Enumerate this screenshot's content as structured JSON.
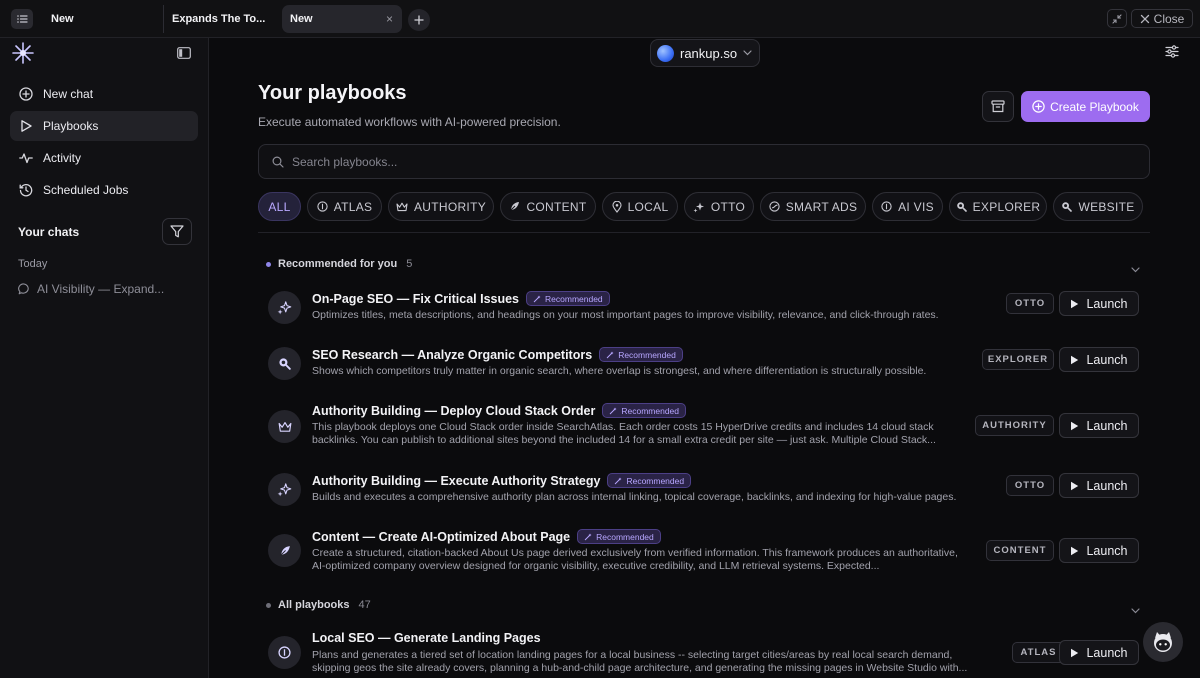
{
  "tabs": [
    {
      "label": "New"
    },
    {
      "label": "Expands The To..."
    },
    {
      "label": "New",
      "close": "×"
    }
  ],
  "window": {
    "close_label": "Close"
  },
  "sidebar": {
    "items": [
      {
        "label": "New chat",
        "icon": "plus-square-icon"
      },
      {
        "label": "Playbooks",
        "icon": "play-icon",
        "active": true
      },
      {
        "label": "Activity",
        "icon": "pulse-icon"
      },
      {
        "label": "Scheduled Jobs",
        "icon": "history-clock-icon"
      }
    ],
    "chats_title": "Your chats",
    "today_label": "Today",
    "chats": [
      {
        "label": "AI Visibility — Expand..."
      }
    ]
  },
  "workspace": {
    "name": "rankup.so"
  },
  "page": {
    "title": "Your playbooks",
    "subtitle": "Execute automated workflows with AI-powered precision.",
    "create_label": "Create Playbook",
    "search_placeholder": "Search playbooks..."
  },
  "filters": [
    {
      "label": "ALL",
      "icon": "",
      "active": true
    },
    {
      "label": "ATLAS",
      "icon": "atlas-icon"
    },
    {
      "label": "AUTHORITY",
      "icon": "crown-icon"
    },
    {
      "label": "CONTENT",
      "icon": "feather-icon"
    },
    {
      "label": "LOCAL",
      "icon": "pin-icon"
    },
    {
      "label": "OTTO",
      "icon": "sparkle-icon"
    },
    {
      "label": "SMART ADS",
      "icon": "ads-icon"
    },
    {
      "label": "AI VIS",
      "icon": "atlas-icon"
    },
    {
      "label": "EXPLORER",
      "icon": "magnifier-icon"
    },
    {
      "label": "WEBSITE",
      "icon": "magnifier-icon"
    }
  ],
  "recommended": {
    "title": "Recommended for you",
    "count": "5",
    "badge_label": "Recommended",
    "launch_label": "Launch",
    "items": [
      {
        "title": "On-Page SEO — Fix Critical Issues",
        "desc": "Optimizes titles, meta descriptions, and headings on your most important pages to improve visibility, relevance, and click-through rates.",
        "tag": "OTTO",
        "icon": "sparkle-icon"
      },
      {
        "title": "SEO Research — Analyze Organic Competitors",
        "desc": "Shows which competitors truly matter in organic search, where overlap is strongest, and where differentiation is structurally possible.",
        "tag": "EXPLORER",
        "icon": "magnifier-icon"
      },
      {
        "title": "Authority Building — Deploy Cloud Stack Order",
        "desc": "This playbook deploys one Cloud Stack order inside SearchAtlas. Each order costs 15 HyperDrive credits and includes 14 cloud stack backlinks. You can publish to additional sites beyond the included 14 for a small extra credit per site — just ask. Multiple Cloud Stack...",
        "tag": "AUTHORITY",
        "icon": "crown-icon"
      },
      {
        "title": "Authority Building — Execute Authority Strategy",
        "desc": "Builds and executes a comprehensive authority plan across internal linking, topical coverage, backlinks, and indexing for high-value pages.",
        "tag": "OTTO",
        "icon": "sparkle-icon"
      },
      {
        "title": "Content — Create AI-Optimized About Page",
        "desc": "Create a structured, citation-backed About Us page derived exclusively from verified information. This framework produces an authoritative, AI-optimized company overview designed for organic visibility, executive credibility, and LLM retrieval systems. Expected...",
        "tag": "CONTENT",
        "icon": "feather-icon"
      }
    ]
  },
  "all": {
    "title": "All playbooks",
    "count": "47",
    "items": [
      {
        "title": "Local SEO — Generate Landing Pages",
        "desc": "Plans and generates a tiered set of location landing pages for a local business -- selecting target cities/areas by real local search demand, skipping geos the site already covers, planning a hub-and-child page architecture, and generating the missing pages in Website Studio with...",
        "tag": "ATLAS",
        "icon": "atlas-icon"
      }
    ]
  },
  "colors": {
    "accent": "#9d6cf0",
    "badge_text": "#b7a6ff",
    "background": "#0b0b0d",
    "sidebar": "#111114"
  }
}
